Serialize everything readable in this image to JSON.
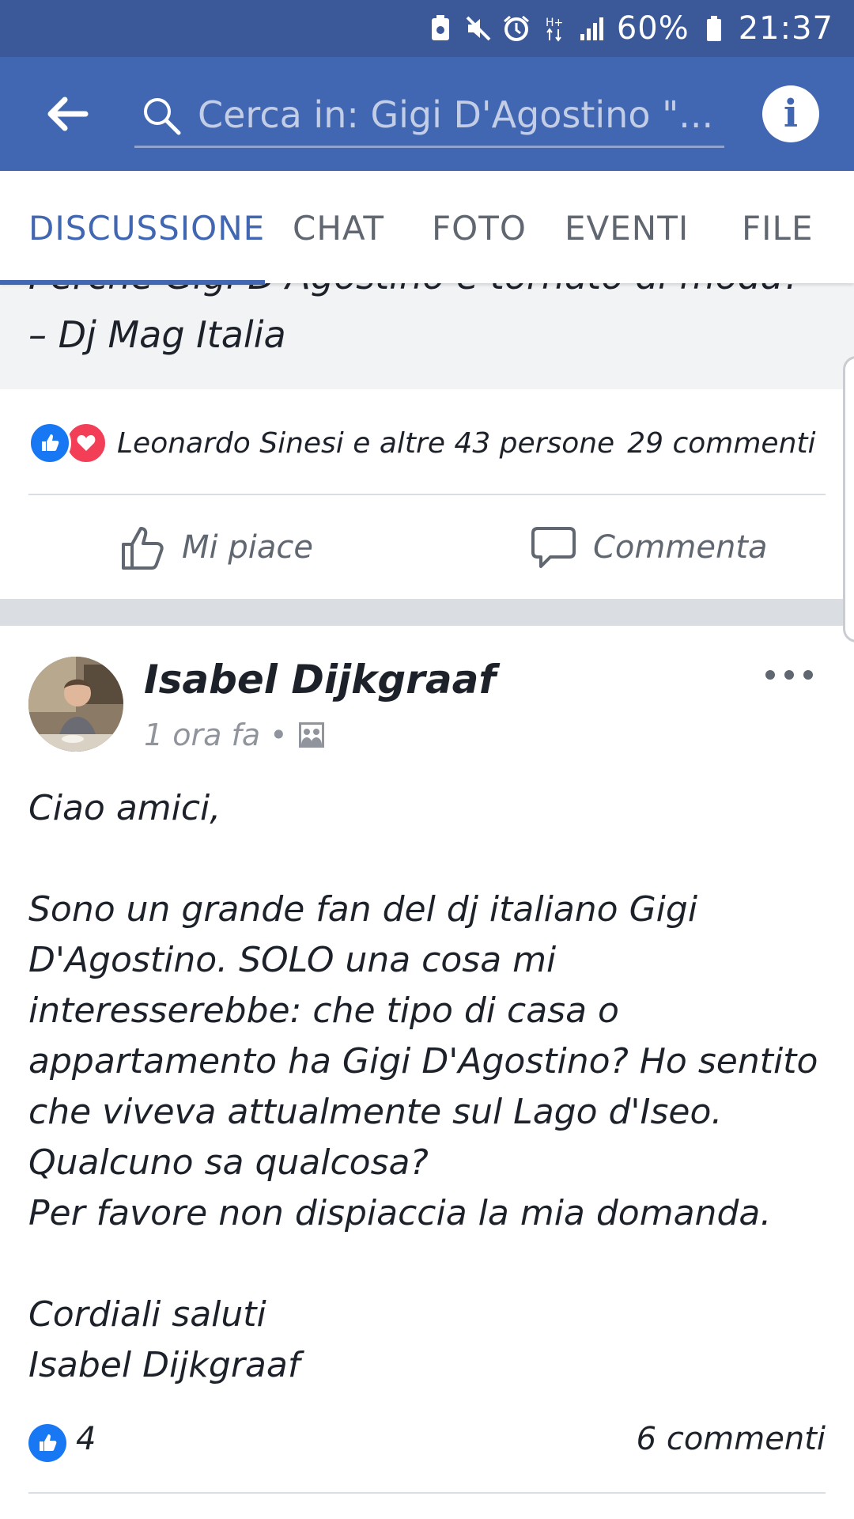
{
  "status_bar": {
    "battery_percent": "60%",
    "time": "21:37",
    "icons": [
      "battery-saver-icon",
      "mute-icon",
      "alarm-icon",
      "hplus-data-icon",
      "signal-icon",
      "battery-icon"
    ]
  },
  "app_bar": {
    "search_placeholder": "Cerca in: Gigi D'Agostino \"...",
    "back_icon": "back-arrow-icon",
    "info_icon": "info-icon"
  },
  "tabs": [
    {
      "label": "DISCUSSIONE",
      "active": true
    },
    {
      "label": "CHAT",
      "active": false
    },
    {
      "label": "FOTO",
      "active": false
    },
    {
      "label": "EVENTI",
      "active": false
    },
    {
      "label": "FILE",
      "active": false
    }
  ],
  "previous_post": {
    "link_title_cut": "Perché Gigi D'Agostino è tornato di moda?",
    "link_title_line2": "– Dj Mag Italia",
    "reactions_text": "Leonardo Sinesi e altre 43 persone",
    "comments_text": "29 commenti",
    "like_label": "Mi piace",
    "comment_label": "Commenta"
  },
  "post": {
    "author": "Isabel Dijkgraaf",
    "time": "1 ora fa",
    "separator": "•",
    "audience_icon": "group-photo-icon",
    "body_lines": [
      "Ciao amici,",
      "",
      "Sono un grande fan del dj italiano Gigi D'Agostino. SOLO una cosa mi interesserebbe: che tipo di casa o appartamento ha Gigi D'Agostino? Ho sentito che viveva attualmente sul Lago d'Iseo. Qualcuno sa qualcosa?",
      "Per favore non dispiaccia la mia domanda.",
      "",
      "Cordiali saluti",
      "Isabel Dijkgraaf"
    ],
    "likes_count": "4",
    "comments_text": "6 commenti"
  },
  "colors": {
    "status_bar": "#3b5998",
    "app_bar": "#4267b2",
    "accent": "#4267b2",
    "like_blue": "#1877f2",
    "love_red": "#f33e58"
  }
}
